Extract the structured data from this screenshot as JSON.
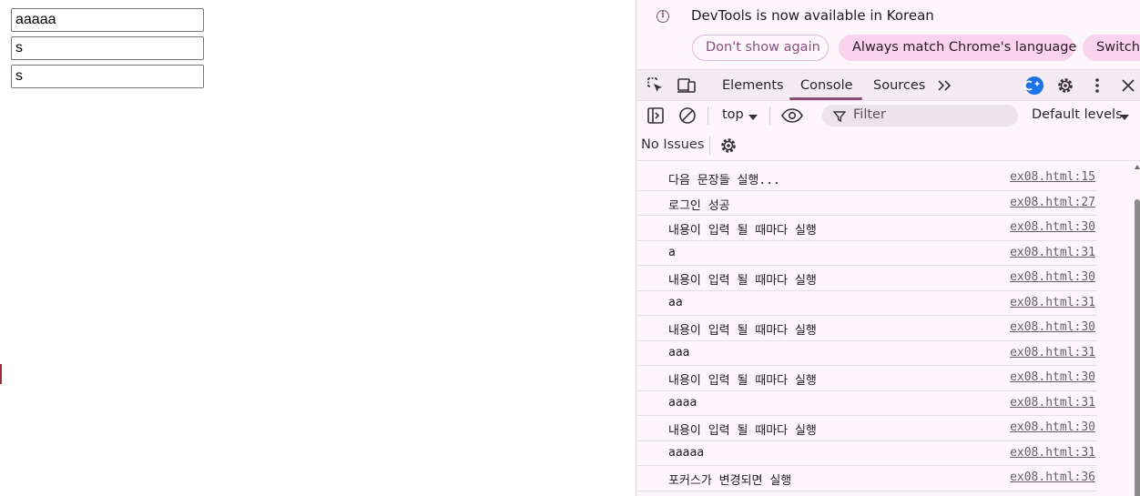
{
  "page": {
    "inputs": [
      {
        "value": "aaaaa"
      },
      {
        "value": "s"
      },
      {
        "value": "s"
      }
    ]
  },
  "devtools": {
    "infobar": {
      "message": "DevTools is now available in Korean",
      "dont_show_label": "Don't show again",
      "always_match_label": "Always match Chrome's language",
      "switch_label": "Switch"
    },
    "tabs": [
      {
        "label": "Elements",
        "active": false
      },
      {
        "label": "Console",
        "active": true
      },
      {
        "label": "Sources",
        "active": false
      }
    ],
    "toolbar": {
      "context": "top",
      "filter_placeholder": "Filter",
      "levels": "Default levels",
      "issues": "No Issues"
    },
    "console_rows": [
      {
        "message": "다음 문장들 실행...",
        "source": "ex08.html:15"
      },
      {
        "message": "로그인 성공",
        "source": "ex08.html:27"
      },
      {
        "message": "내용이 입력 될 때마다 실행",
        "source": "ex08.html:30"
      },
      {
        "message": "a",
        "source": "ex08.html:31"
      },
      {
        "message": "내용이 입력 될 때마다 실행",
        "source": "ex08.html:30"
      },
      {
        "message": "aa",
        "source": "ex08.html:31"
      },
      {
        "message": "내용이 입력 될 때마다 실행",
        "source": "ex08.html:30"
      },
      {
        "message": "aaa",
        "source": "ex08.html:31"
      },
      {
        "message": "내용이 입력 될 때마다 실행",
        "source": "ex08.html:30"
      },
      {
        "message": "aaaa",
        "source": "ex08.html:31"
      },
      {
        "message": "내용이 입력 될 때마다 실행",
        "source": "ex08.html:30"
      },
      {
        "message": "aaaaa",
        "source": "ex08.html:31"
      },
      {
        "message": "포커스가 변경되면 실행",
        "source": "ex08.html:36"
      }
    ],
    "colors": {
      "accent": "#8a4f7d",
      "badge_blue": "#1a73e8",
      "pill_fill": "#fad3ee"
    }
  }
}
